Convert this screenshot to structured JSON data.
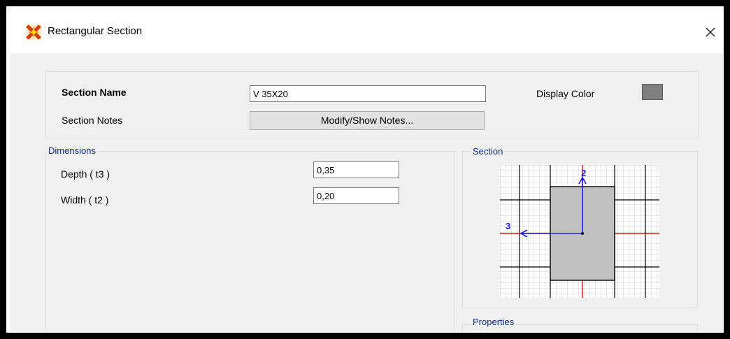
{
  "window": {
    "title": "Rectangular Section",
    "close_glyph": "✕"
  },
  "section_name": {
    "label": "Section Name",
    "value": "V 35X20"
  },
  "section_notes": {
    "label": "Section Notes",
    "button": "Modify/Show Notes..."
  },
  "display_color": {
    "label": "Display Color",
    "color": "#7f7f7f"
  },
  "dimensions": {
    "caption": "Dimensions",
    "depth": {
      "label": "Depth  ( t3 )",
      "value": "0,35"
    },
    "width": {
      "label": "Width  ( t2 )",
      "value": "0,20"
    }
  },
  "section_preview": {
    "caption": "Section",
    "axis_2_label": "2",
    "axis_3_label": "3"
  },
  "properties": {
    "caption": "Properties"
  },
  "icons": {
    "app": "etabs-app-icon",
    "close": "close-icon"
  }
}
